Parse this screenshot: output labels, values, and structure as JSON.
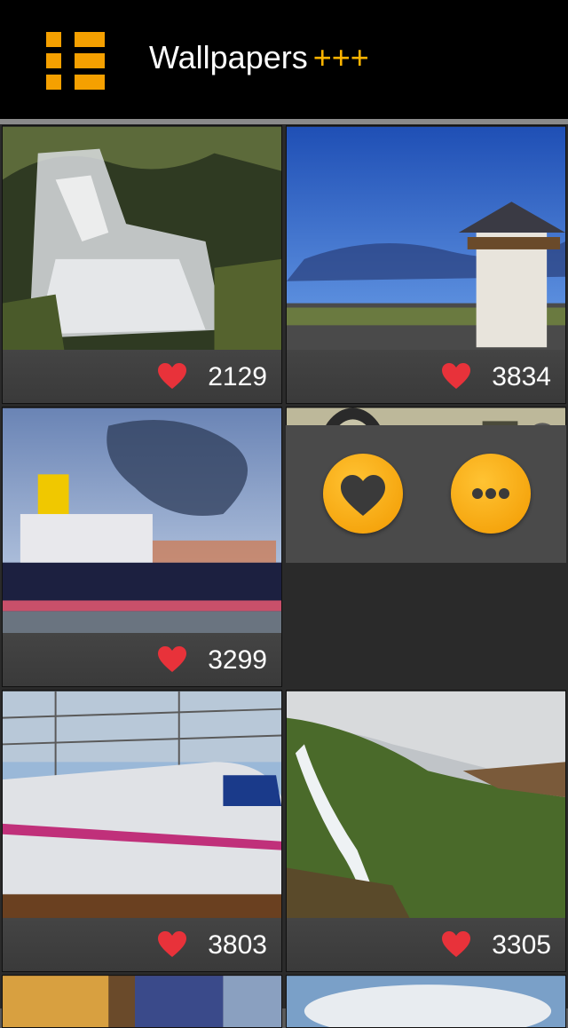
{
  "header": {
    "title": "Wallpapers",
    "title_accent": "+++"
  },
  "icons": {
    "menu": "grid-menu-icon",
    "favorite": "heart-icon",
    "favorite_action": "heart-circle-icon",
    "more_action": "more-dots-icon"
  },
  "colors": {
    "accent": "#f5a000",
    "heart": "#e8323a",
    "header_bg": "#000000"
  },
  "wallpapers": [
    {
      "subject": "waterfall",
      "likes": "2129"
    },
    {
      "subject": "tower",
      "likes": "3834"
    },
    {
      "subject": "ship",
      "likes": "3299"
    },
    {
      "subject": "vintage-car"
    },
    {
      "subject": "bullet-train",
      "likes": "3803"
    },
    {
      "subject": "hillside-waterfall",
      "likes": "3305"
    },
    {
      "subject": "interior"
    },
    {
      "subject": "sky"
    }
  ]
}
